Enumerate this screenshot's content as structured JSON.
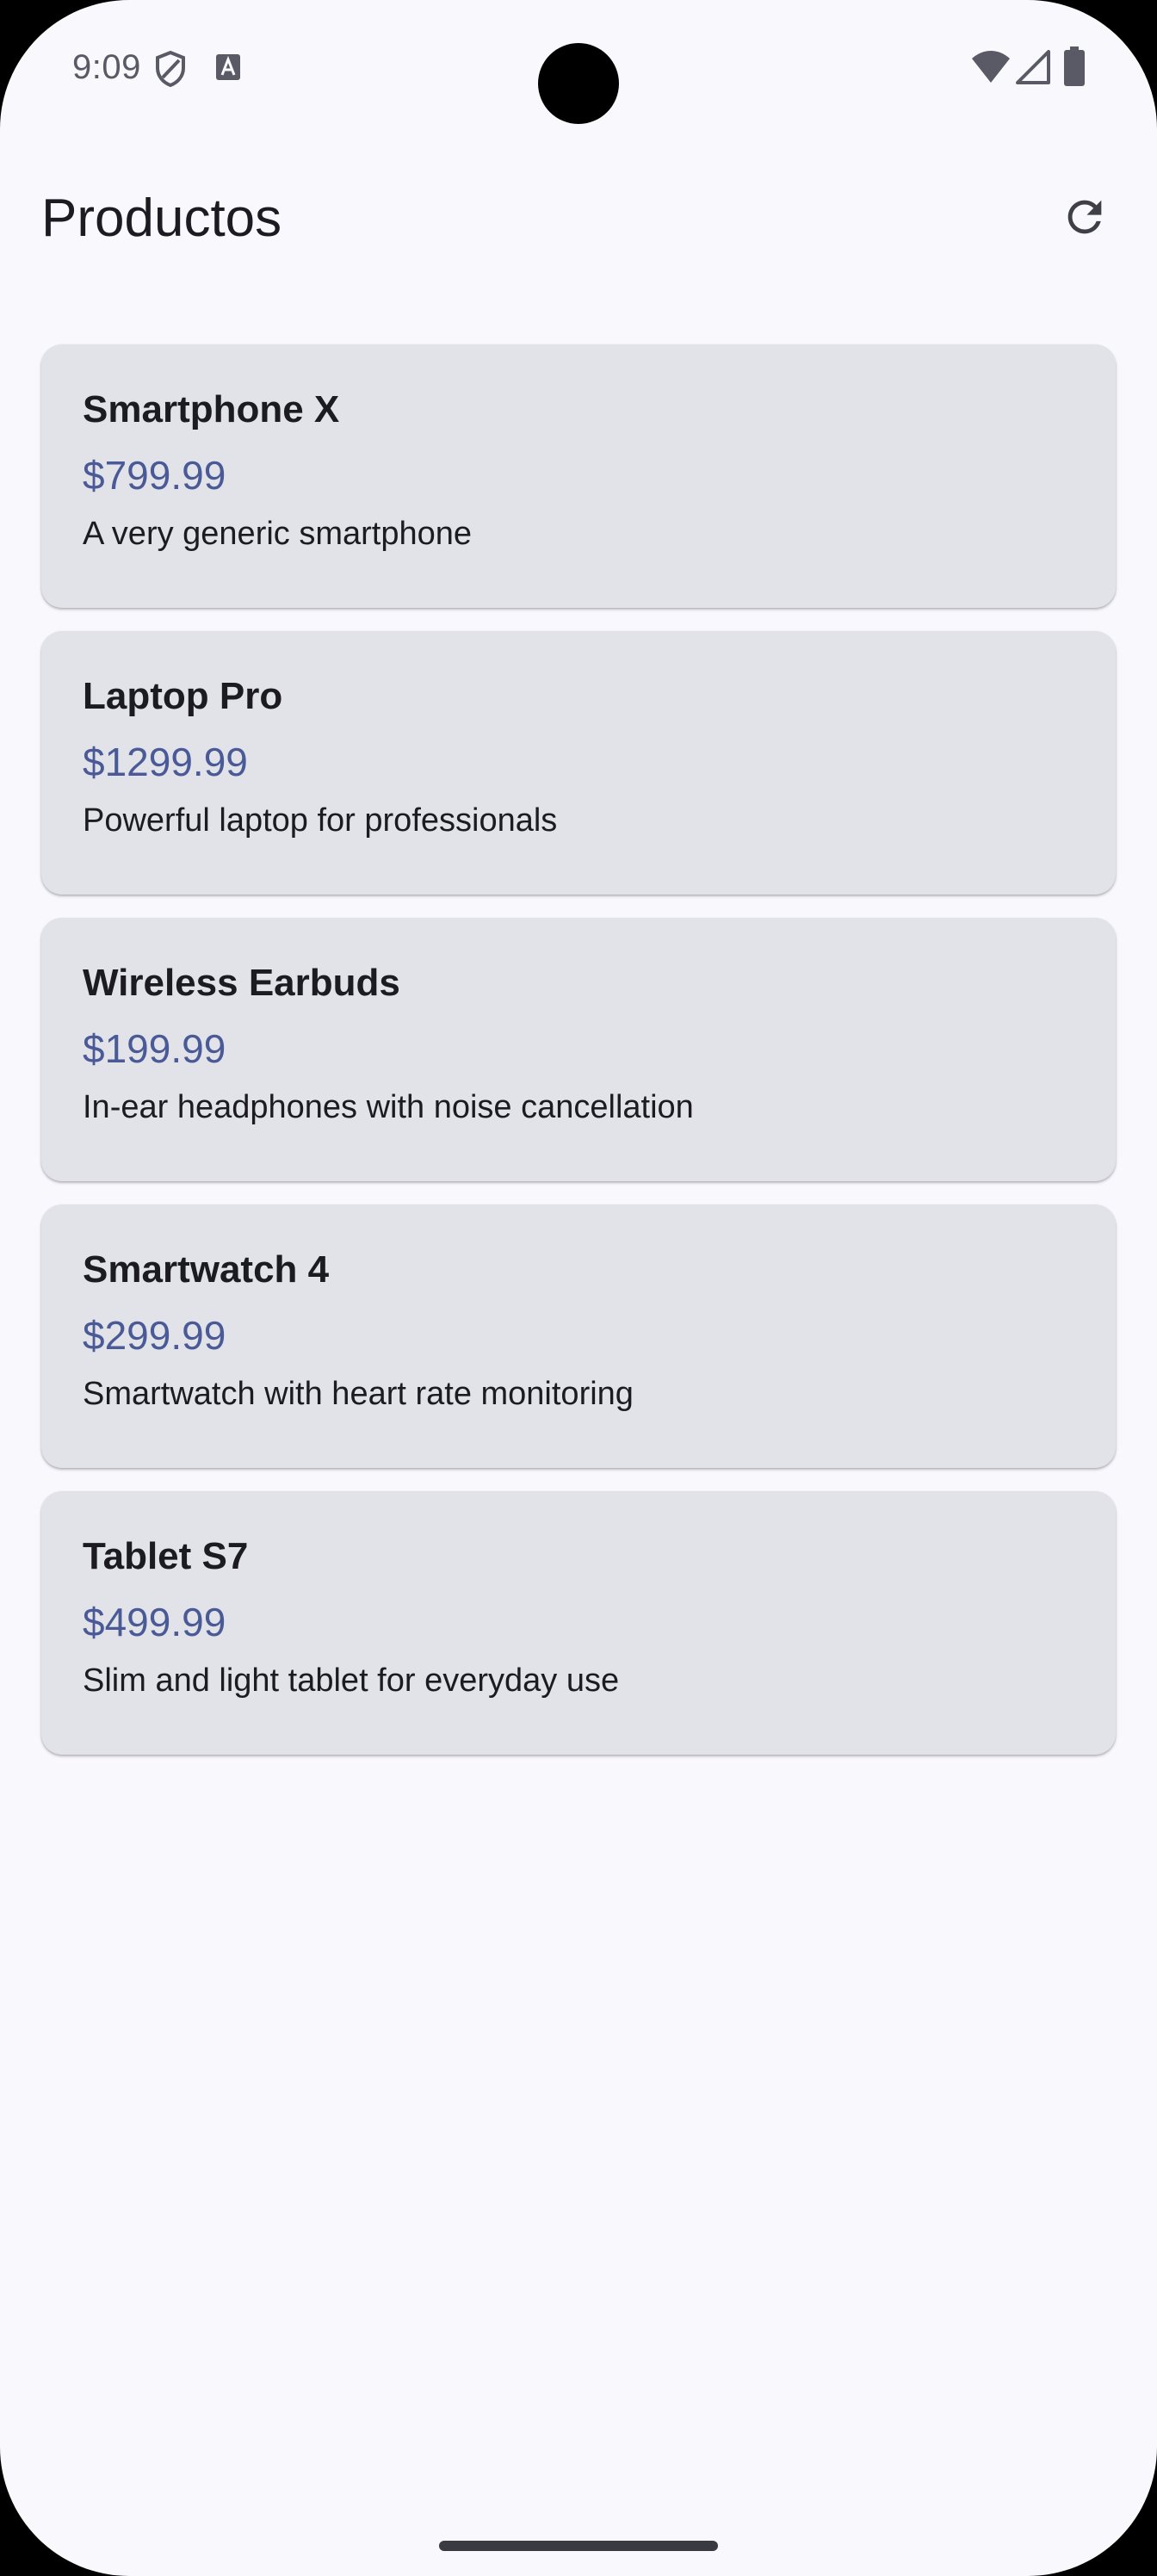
{
  "status_bar": {
    "time": "9:09",
    "icons": [
      "shield-icon",
      "text-a-icon",
      "wifi-icon",
      "cell-signal-icon",
      "battery-icon"
    ]
  },
  "app_bar": {
    "title": "Productos",
    "refresh_icon": "refresh-icon"
  },
  "products": [
    {
      "name": "Smartphone X",
      "price": "$799.99",
      "description": "A very generic smartphone"
    },
    {
      "name": "Laptop Pro",
      "price": "$1299.99",
      "description": "Powerful laptop for professionals"
    },
    {
      "name": "Wireless Earbuds",
      "price": "$199.99",
      "description": "In-ear headphones with noise cancellation"
    },
    {
      "name": "Smartwatch 4",
      "price": "$299.99",
      "description": "Smartwatch with heart rate monitoring"
    },
    {
      "name": "Tablet S7",
      "price": "$499.99",
      "description": "Slim and light tablet for everyday use"
    }
  ],
  "colors": {
    "background": "#f9f8fd",
    "card": "#e2e2e9",
    "price": "#4a5a96",
    "text": "#1b1b21"
  }
}
